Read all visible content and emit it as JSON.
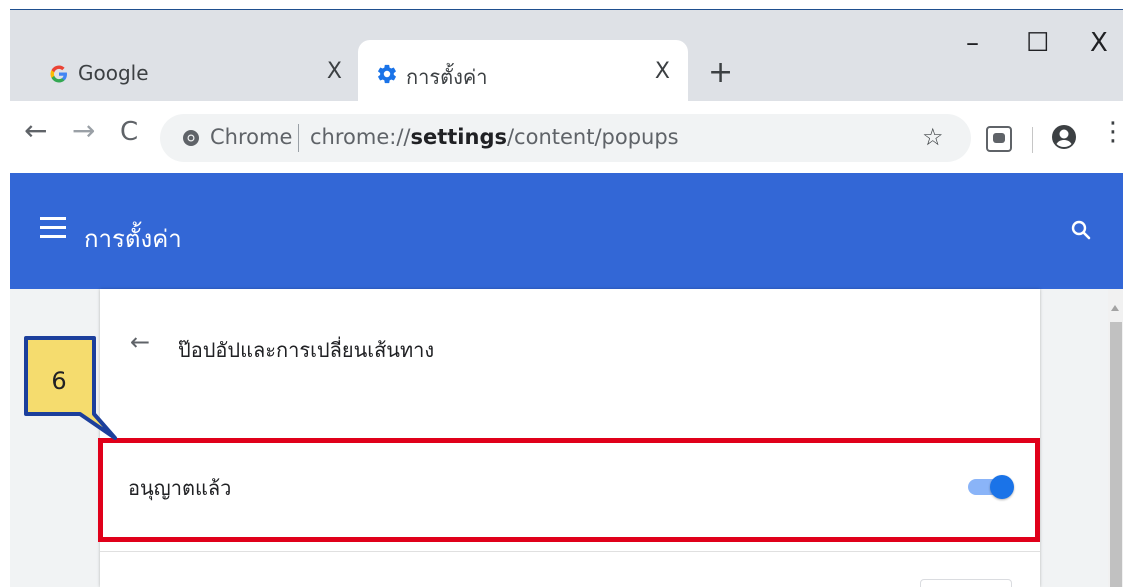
{
  "tabs": [
    {
      "title": "Google",
      "favicon": "google-g-icon",
      "close": "X",
      "active": false
    },
    {
      "title": "การตั้งค่า",
      "favicon": "gear-icon",
      "close": "X",
      "active": true
    }
  ],
  "new_tab": "+",
  "window_controls": {
    "minimize": "–",
    "maximize": "☐",
    "close": "X"
  },
  "toolbar": {
    "back": "←",
    "forward": "→",
    "reload": "C",
    "omnibox_chip": "Chrome",
    "url_prefix": "chrome://",
    "url_host": "settings",
    "url_path": "/content/popups",
    "star": "☆",
    "menu": "⋮"
  },
  "header": {
    "title": "การตั้งค่า"
  },
  "subpage": {
    "back": "←",
    "title": "ป๊อปอัปและการเปลี่ยนเส้นทาง",
    "row_label": "อนุญาตแล้ว",
    "toggle_on": true
  },
  "annotation": {
    "step": "6"
  },
  "colors": {
    "header_blue": "#3367d6",
    "toggle_blue": "#1a73e8",
    "highlight_red": "#e0001a",
    "callout_fill": "#f5dc6e",
    "callout_border": "#1c3f9c"
  }
}
